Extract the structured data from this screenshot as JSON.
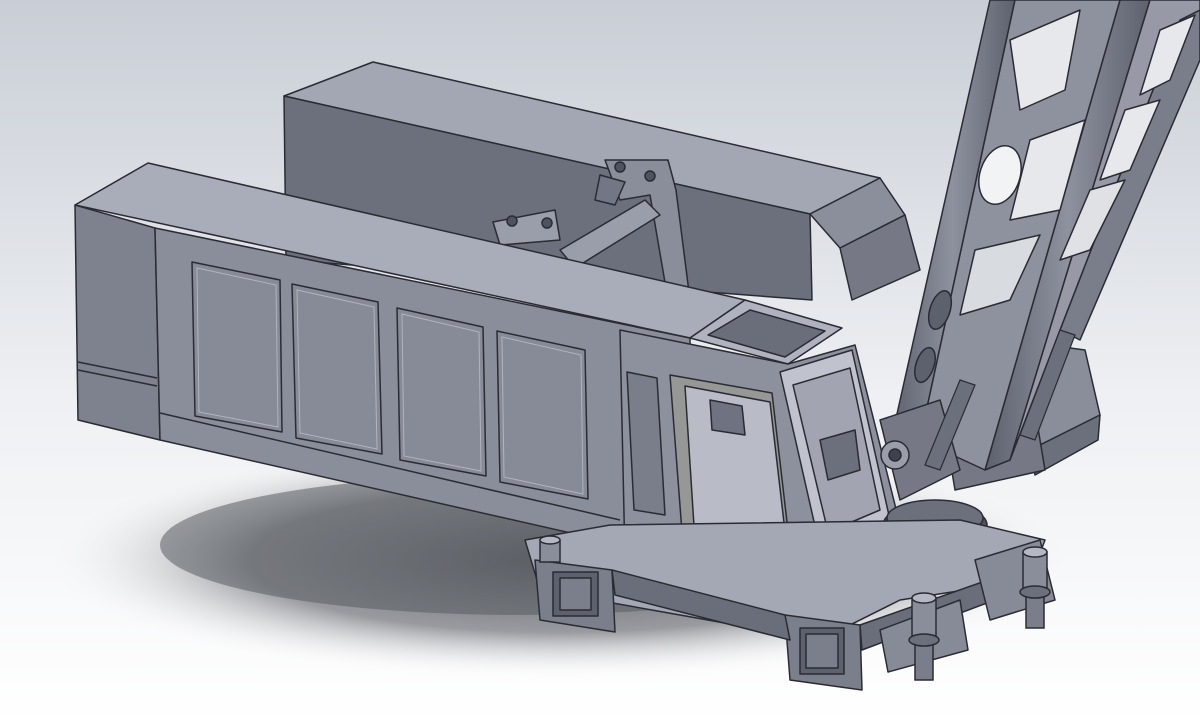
{
  "scene": {
    "subject": "crane-upper-structure-cad-model",
    "colors": {
      "background_top": "#d9dde3",
      "background_bottom": "#ffffff",
      "shadow": "#6b6e74",
      "body_light": "#a7aab7",
      "body_mid": "#8e919e",
      "body_dark": "#6f7280",
      "body_darkest": "#4f5260",
      "edge": "#2a2c33",
      "highlight": "#c4c7d2"
    }
  }
}
